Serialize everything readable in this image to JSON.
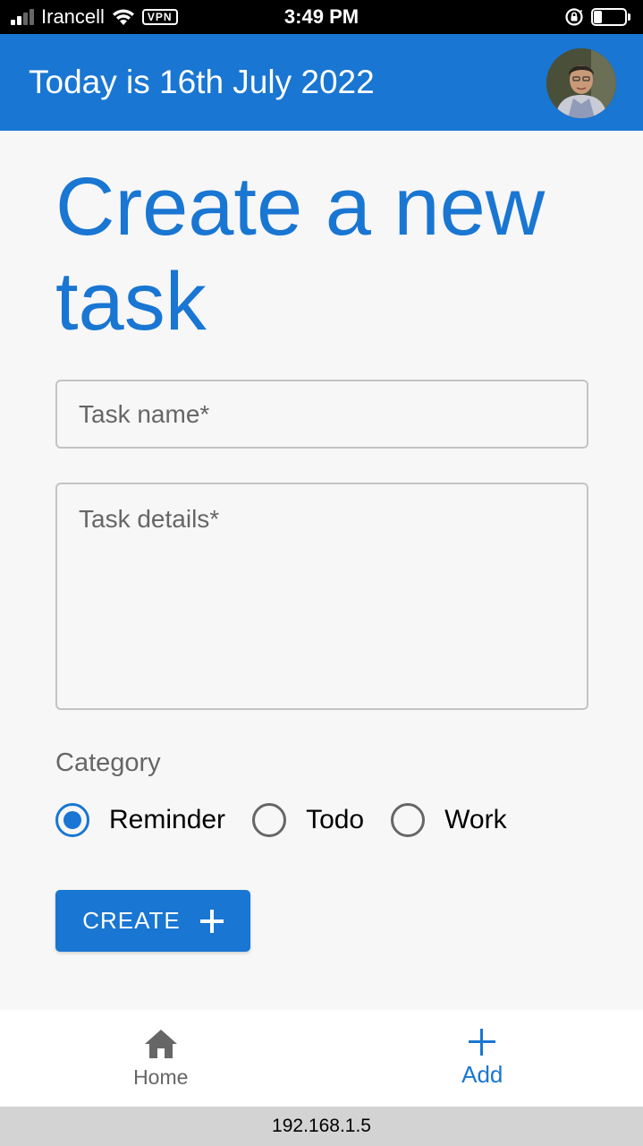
{
  "status_bar": {
    "carrier": "Irancell",
    "vpn": "VPN",
    "time": "3:49 PM"
  },
  "app_bar": {
    "title": "Today is 16th July 2022"
  },
  "page": {
    "title": "Create a new task"
  },
  "form": {
    "task_name_placeholder": "Task name*",
    "task_details_placeholder": "Task details*",
    "category_label": "Category",
    "categories": [
      {
        "label": "Reminder",
        "selected": true
      },
      {
        "label": "Todo",
        "selected": false
      },
      {
        "label": "Work",
        "selected": false
      }
    ],
    "create_label": "CREATE"
  },
  "bottom_nav": {
    "items": [
      {
        "label": "Home",
        "icon": "home-icon",
        "active": false
      },
      {
        "label": "Add",
        "icon": "add-icon",
        "active": true
      }
    ]
  },
  "url_bar": {
    "address": "192.168.1.5"
  },
  "colors": {
    "primary": "#1976d2",
    "background": "#f7f7f7",
    "inactive": "#666666"
  }
}
